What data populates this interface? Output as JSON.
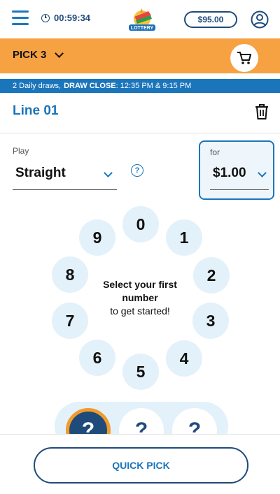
{
  "header": {
    "timer": "00:59:34",
    "balance": "$95.00",
    "logo_text": "LOTTERY"
  },
  "game": {
    "name": "PICK 3"
  },
  "draw_info": {
    "prefix": "2 Daily draws,",
    "label": "DRAW CLOSE",
    "times": ": 12:35 PM & 9:15 PM"
  },
  "line": {
    "title": "Line 01"
  },
  "play": {
    "label": "Play",
    "value": "Straight",
    "help": "?"
  },
  "amount": {
    "label": "for",
    "value": "$1.00"
  },
  "dial": {
    "numbers": [
      "0",
      "1",
      "2",
      "3",
      "4",
      "5",
      "6",
      "7",
      "8",
      "9"
    ],
    "prompt_strong": "Select your first number",
    "prompt": "to get started!"
  },
  "slots": [
    "?",
    "?",
    "?"
  ],
  "actions": {
    "quick_pick": "QUICK PICK"
  },
  "colors": {
    "primary_blue": "#1b75bb",
    "navy": "#1f4b7a",
    "orange": "#f6a142",
    "light_blue": "#e3f1fa"
  }
}
